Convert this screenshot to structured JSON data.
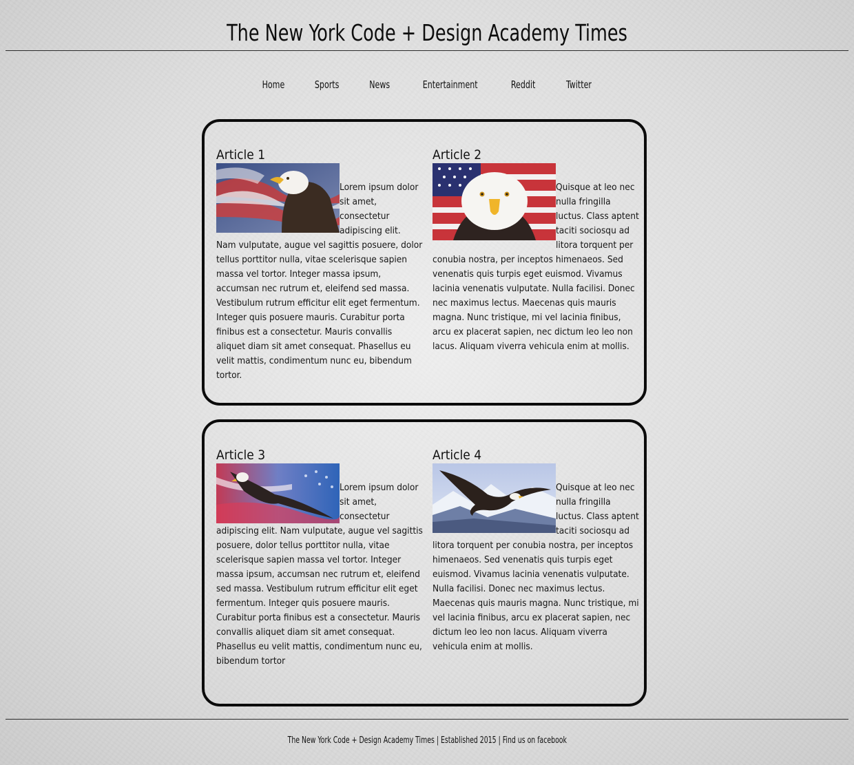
{
  "site": {
    "title": "The New York Code + Design Academy Times"
  },
  "nav": {
    "items": [
      "Home",
      "Sports",
      "News",
      "Entertainment",
      "Reddit",
      "Twitter"
    ]
  },
  "articles": [
    {
      "title": "Article 1",
      "image": "eagle-flag-profile",
      "text": "Lorem ipsum dolor sit amet, consectetur adipiscing elit. Nam vulputate, augue vel sagittis posuere, dolor tellus porttitor nulla, vitae scelerisque sapien massa vel tortor. Integer massa ipsum, accumsan nec rutrum et, eleifend sed massa. Vestibulum rutrum efficitur elit eget fermentum. Integer quis posuere mauris. Curabitur porta finibus est a consectetur. Mauris convallis aliquet diam sit amet consequat. Phasellus eu velit mattis, condimentum nunc eu, bibendum tortor."
    },
    {
      "title": "Article 2",
      "image": "eagle-flag-front",
      "text": "Quisque at leo nec nulla fringilla luctus. Class aptent taciti sociosqu ad litora torquent per conubia nostra, per inceptos himenaeos. Sed venenatis quis turpis eget euismod. Vivamus lacinia venenatis vulputate. Nulla facilisi. Donec nec maximus lectus. Maecenas quis mauris magna. Nunc tristique, mi vel lacinia finibus, arcu ex placerat sapien, nec dictum leo leo non lacus. Aliquam viverra vehicula enim at mollis."
    },
    {
      "title": "Article 3",
      "image": "eagle-flag-flying",
      "text": "Lorem ipsum dolor sit amet, consectetur adipiscing elit. Nam vulputate, augue vel sagittis posuere, dolor tellus porttitor nulla, vitae scelerisque sapien massa vel tortor. Integer massa ipsum, accumsan nec rutrum et, eleifend sed massa. Vestibulum rutrum efficitur elit eget fermentum. Integer quis posuere mauris. Curabitur porta finibus est a consectetur. Mauris convallis aliquet diam sit amet consequat. Phasellus eu velit mattis, condimentum nunc eu, bibendum tortor"
    },
    {
      "title": "Article 4",
      "image": "eagle-mountains-flying",
      "text": "Quisque at leo nec nulla fringilla luctus. Class aptent taciti sociosqu ad litora torquent per conubia nostra, per inceptos himenaeos. Sed venenatis quis turpis eget euismod. Vivamus lacinia venenatis vulputate. Nulla facilisi. Donec nec maximus lectus. Maecenas quis mauris magna. Nunc tristique, mi vel lacinia finibus, arcu ex placerat sapien, nec dictum leo leo non lacus. Aliquam viverra vehicula enim at mollis."
    }
  ],
  "footer": {
    "site_name": "The New York Code + Design Academy Times",
    "separator": "|",
    "established": "Established 2015",
    "find_us_prefix": "Find us on",
    "facebook_link": "facebook"
  },
  "colors": {
    "border": "#0b0b0b",
    "text": "#111111",
    "background": "#d9d9d9"
  }
}
